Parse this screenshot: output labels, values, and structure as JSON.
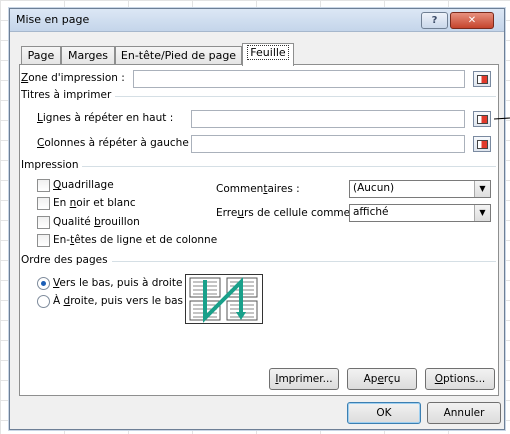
{
  "window": {
    "title": "Mise en page",
    "help_label": "?",
    "close_label": "✕"
  },
  "tabs": [
    {
      "label": "Page"
    },
    {
      "label": "Marges"
    },
    {
      "label": "En-tête/Pied de page"
    },
    {
      "label": "Feuille",
      "active": true
    }
  ],
  "print_area": {
    "label": "Zone d'impression :",
    "value": ""
  },
  "print_titles": {
    "group_label": "Titres à imprimer",
    "rows_label": "Lignes à répéter en haut :",
    "rows_value": "",
    "cols_label": "Colonnes à répéter à gauche :",
    "cols_value": ""
  },
  "print": {
    "group_label": "Impression",
    "checkboxes": [
      {
        "label": "Quadrillage",
        "checked": false
      },
      {
        "label": "En noir et blanc",
        "checked": false
      },
      {
        "label": "Qualité brouillon",
        "checked": false
      },
      {
        "label": "En-têtes de ligne et de colonne",
        "checked": false
      }
    ],
    "comments_label": "Commentaires :",
    "comments_value": "(Aucun)",
    "errors_label": "Erreurs de cellule comme :",
    "errors_value": "affiché"
  },
  "page_order": {
    "group_label": "Ordre des pages",
    "options": [
      {
        "label": "Vers le bas, puis à droite",
        "selected": true
      },
      {
        "label": "À droite, puis vers le bas",
        "selected": false
      }
    ]
  },
  "buttons": {
    "print": "Imprimer...",
    "preview": "Aperçu",
    "options": "Options...",
    "ok": "OK",
    "cancel": "Annuler"
  },
  "colors": {
    "accent": "#1d5fb6",
    "close": "#c5442d",
    "diagram_arrow": "#19a08a"
  },
  "icons": [
    "ref-select-icon",
    "page-order-diagram-icon",
    "dropdown-arrow-icon"
  ]
}
